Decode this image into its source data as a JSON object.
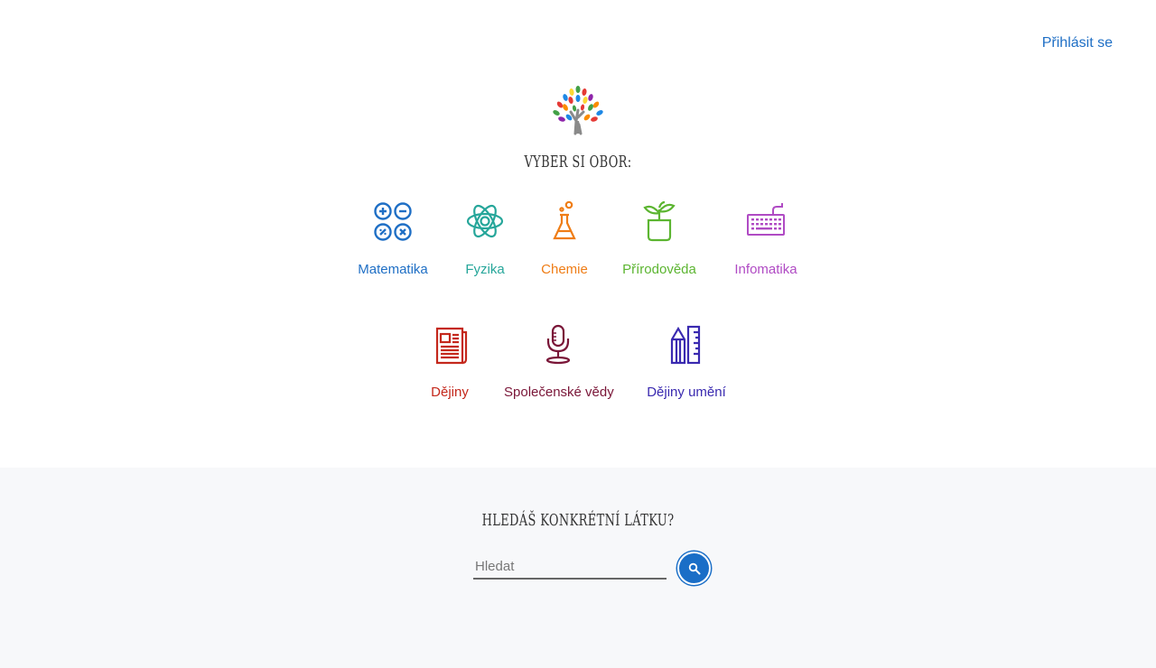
{
  "header": {
    "login_label": "Přihlásit se"
  },
  "headings": {
    "choose_subject": "VYBER SI OBOR:",
    "search_question": "HLEDÁŠ KONKRÉTNÍ LÁTKU?"
  },
  "subjects": [
    {
      "label": "Matematika",
      "icon": "math-operators-icon",
      "color": "#1f6fc5"
    },
    {
      "label": "Fyzika",
      "icon": "atom-icon",
      "color": "#26a69a"
    },
    {
      "label": "Chemie",
      "icon": "flask-icon",
      "color": "#ef7d16"
    },
    {
      "label": "Přírodověda",
      "icon": "plant-pot-icon",
      "color": "#5cb531"
    },
    {
      "label": "Infomatika",
      "icon": "keyboard-icon",
      "color": "#b04bc4"
    },
    {
      "label": "Dějiny",
      "icon": "newspaper-icon",
      "color": "#c4281c"
    },
    {
      "label": "Společenské vědy",
      "icon": "microphone-icon",
      "color": "#7a1638"
    },
    {
      "label": "Dějiny umění",
      "icon": "pencil-ruler-icon",
      "color": "#3a2ab0"
    }
  ],
  "search": {
    "placeholder": "Hledat",
    "button_color": "#1a6ec7"
  }
}
